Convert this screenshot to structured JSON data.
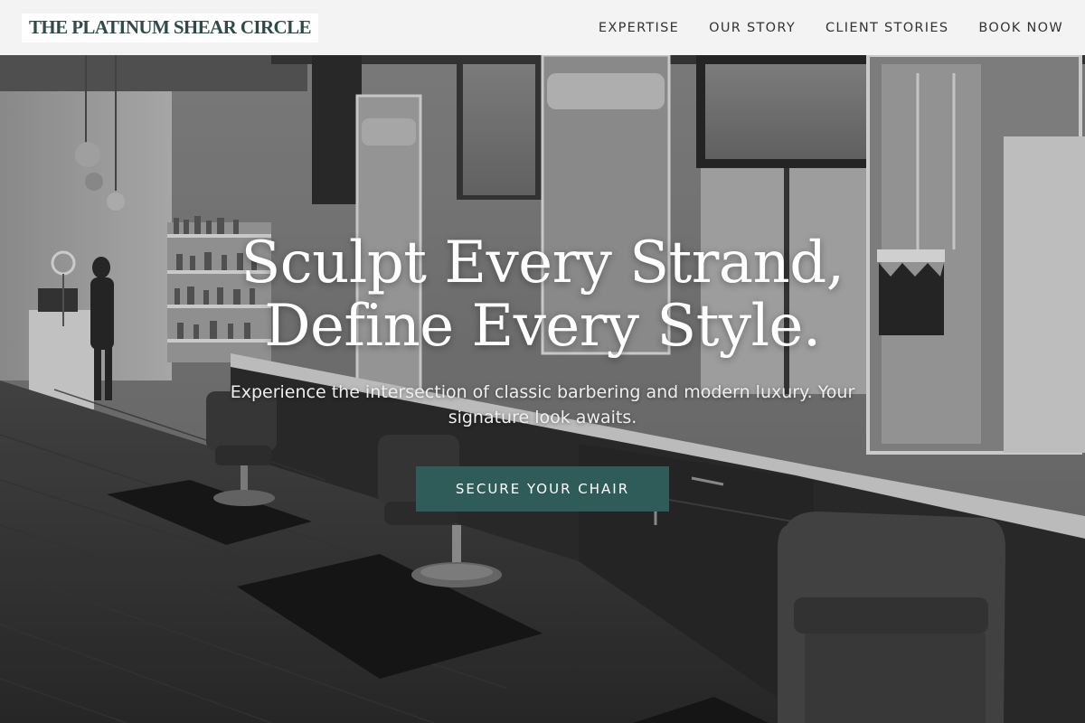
{
  "header": {
    "brand": "THE PLATINUM SHEAR CIRCLE",
    "nav": [
      {
        "label": "EXPERTISE"
      },
      {
        "label": "OUR STORY"
      },
      {
        "label": "CLIENT STORIES"
      },
      {
        "label": "BOOK NOW"
      }
    ]
  },
  "hero": {
    "title_line1": "Sculpt Every Strand,",
    "title_line2": "Define Every Style.",
    "subtitle": "Experience the intersection of classic barbering and modern luxury. Your signature look awaits.",
    "cta_label": "SECURE YOUR CHAIR"
  },
  "colors": {
    "brand_text": "#2f4a47",
    "header_bg": "#f3f3f3",
    "cta_bg": "#2f5c58",
    "hero_text": "#ffffff"
  }
}
